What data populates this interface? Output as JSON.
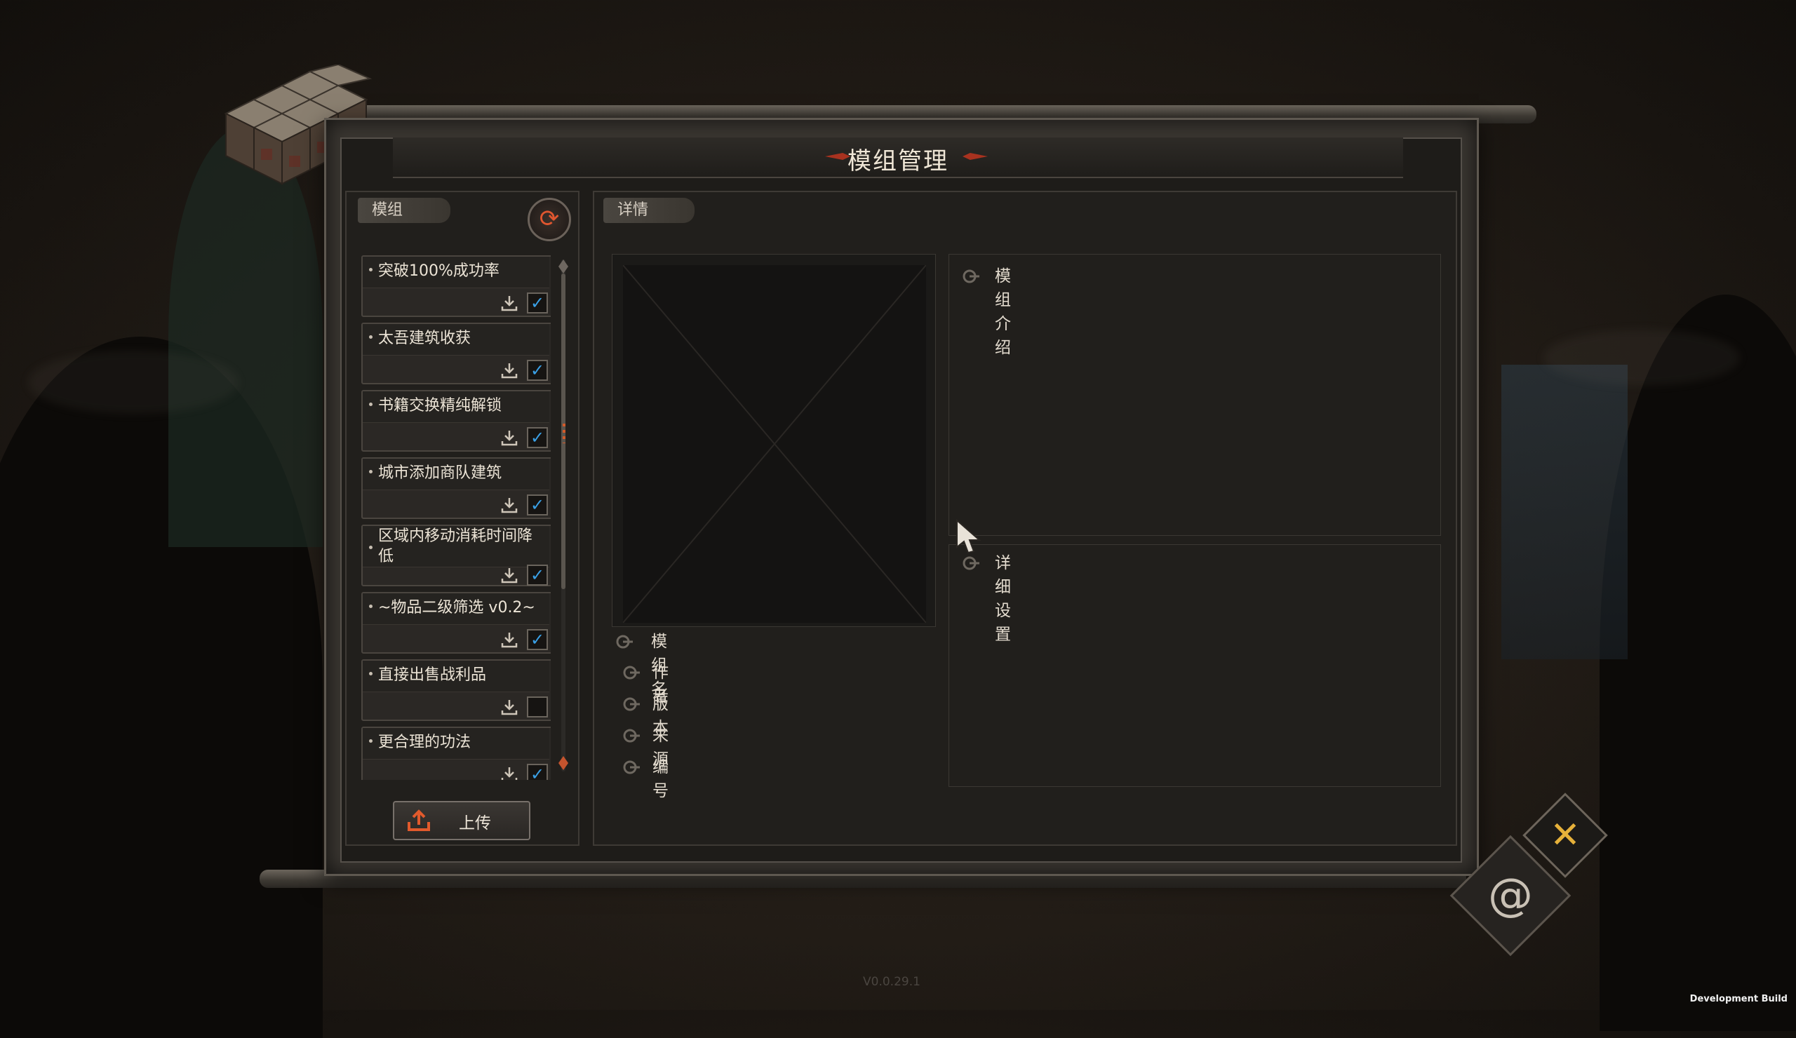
{
  "title": "模组管理",
  "left_panel": {
    "tab_label": "模组",
    "refresh_icon": "refresh-icon",
    "mods": [
      {
        "name": "突破100%成功率",
        "enabled": true
      },
      {
        "name": "太吾建筑收获",
        "enabled": true
      },
      {
        "name": "书籍交换精纯解锁",
        "enabled": true
      },
      {
        "name": "城市添加商队建筑",
        "enabled": true
      },
      {
        "name": "区域内移动消耗时间降低",
        "enabled": true
      },
      {
        "name": "~物品二级筛选 v0.2~",
        "enabled": true
      },
      {
        "name": "直接出售战利品",
        "enabled": false
      },
      {
        "name": "更合理的功法",
        "enabled": true
      }
    ],
    "upload_label": "上传"
  },
  "right_panel": {
    "tab_label": "详情",
    "fields": {
      "mod_name": "模组名",
      "author": "作者",
      "version": "版本",
      "source": "来源",
      "id": "编号"
    },
    "intro_label": "模组介绍",
    "settings_label": "详细设置"
  },
  "footer": {
    "version_text": "V0.0.29.1",
    "dev_build": "Development Build"
  },
  "colors": {
    "accent_red": "#a8321f",
    "check_blue": "#3aa0e6",
    "close_gold": "#e6b13a"
  }
}
